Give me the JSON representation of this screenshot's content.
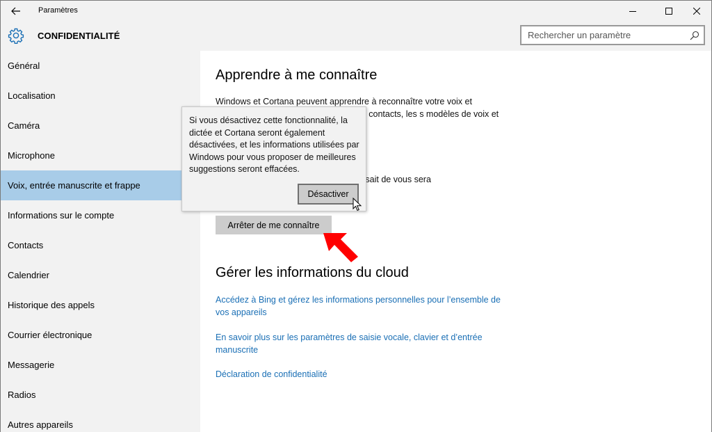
{
  "window": {
    "title": "Paramètres",
    "back_icon": "arrow-left-icon",
    "minimize_icon": "minimize-icon",
    "maximize_icon": "maximize-icon",
    "close_icon": "close-icon"
  },
  "header": {
    "section_icon": "gear-icon",
    "section_title": "CONFIDENTIALITÉ",
    "search": {
      "placeholder": "Rechercher un paramètre",
      "value": "",
      "icon": "search-icon"
    }
  },
  "sidebar": {
    "items": [
      {
        "label": "Général"
      },
      {
        "label": "Localisation"
      },
      {
        "label": "Caméra"
      },
      {
        "label": "Microphone"
      },
      {
        "label": "Voix, entrée manuscrite et frappe",
        "selected": true
      },
      {
        "label": "Informations sur le compte"
      },
      {
        "label": "Contacts"
      },
      {
        "label": "Calendrier"
      },
      {
        "label": "Historique des appels"
      },
      {
        "label": "Courrier électronique"
      },
      {
        "label": "Messagerie"
      },
      {
        "label": "Radios"
      },
      {
        "label": "Autres appareils"
      }
    ],
    "selected_color": "#a8cce8"
  },
  "main": {
    "section1_title": "Apprendre à me connaître",
    "description1": "Windows et Cortana peuvent apprendre à reconnaître votre voix et meilleures suggestions. Nous s que les contacts, les s modèles de voix et d’écriture s frappes.",
    "description2": "té, la dictée et Cortana seront appareil sait de vous sera",
    "stop_button": "Arrêter de me connaître",
    "section2_title": "Gérer les informations du cloud",
    "link_bing": "Accédez à Bing et gérez les informations personnelles pour l’ensemble de vos appareils",
    "link_learn_more": "En savoir plus sur les paramètres de saisie vocale, clavier et d’entrée manuscrite",
    "link_privacy": "Déclaration de confidentialité",
    "link_color": "#1a6fb5"
  },
  "popup": {
    "message": "Si vous désactivez cette fonctionnalité, la dictée et Cortana seront également désactivées, et les informations utilisées par Windows pour vous proposer de meilleures suggestions seront effacées.",
    "confirm_button": "Désactiver"
  },
  "annotation": {
    "arrow_icon": "red-arrow-icon",
    "arrow_color": "#ff0000",
    "cursor_icon": "mouse-pointer-icon"
  }
}
